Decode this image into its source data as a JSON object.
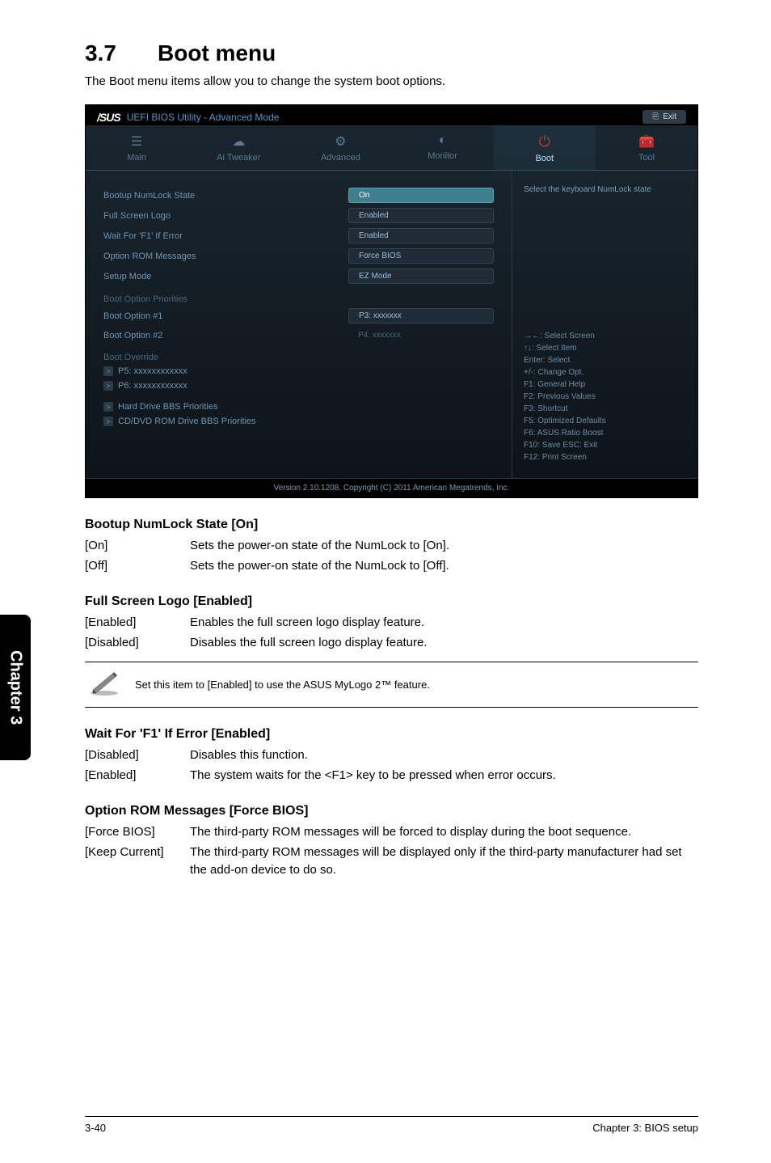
{
  "section": {
    "number": "3.7",
    "title": "Boot menu"
  },
  "intro": "The Boot menu items allow you to change the system boot options.",
  "bios": {
    "logo_brand": "/SUS",
    "header_title": "UEFI BIOS Utility - Advanced Mode",
    "exit_label": "Exit",
    "tabs": {
      "main": "Main",
      "ai": "Ai  Tweaker",
      "advanced": "Advanced",
      "monitor": "Monitor",
      "boot": "Boot",
      "tool": "Tool"
    },
    "rows": {
      "numlock": {
        "label": "Bootup NumLock State",
        "value": "On"
      },
      "logo": {
        "label": "Full Screen Logo",
        "value": "Enabled"
      },
      "f1": {
        "label": "Wait For 'F1' If Error",
        "value": "Enabled"
      },
      "rom": {
        "label": "Option ROM Messages",
        "value": "Force BIOS"
      },
      "setup": {
        "label": "Setup Mode",
        "value": "EZ Mode"
      }
    },
    "priorities_header": "Boot Option Priorities",
    "boot1": {
      "label": "Boot Option #1",
      "value": "P3: xxxxxxx"
    },
    "boot2": {
      "label": "Boot Option #2",
      "value": "P4: xxxxxxx"
    },
    "override_header": "Boot Override",
    "override": {
      "p5": "P5: xxxxxxxxxxxx",
      "p6": "P6: xxxxxxxxxxxx",
      "hdd": "Hard Drive BBS Priorities",
      "cd": "CD/DVD ROM Drive BBS Priorities"
    },
    "help_top": "Select the keyboard NumLock state",
    "help_keys": "→←:  Select Screen\n↑↓:  Select Item\nEnter:  Select\n+/-:  Change Opt.\nF1:  General Help\nF2:  Previous Values\nF3:  Shortcut\nF5:  Optimized Defaults\nF6:  ASUS Ratio Boost\nF10:  Save   ESC:  Exit\nF12:  Print Screen",
    "footer": "Version  2.10.1208.   Copyright  (C)  2011 American  Megatrends,  Inc."
  },
  "doc": {
    "numlock": {
      "title": "Bootup NumLock State [On]",
      "on": {
        "k": "[On]",
        "v": "Sets the power-on state of the NumLock to [On]."
      },
      "off": {
        "k": "[Off]",
        "v": "Sets the power-on state of the NumLock to [Off]."
      }
    },
    "logo": {
      "title": "Full Screen Logo [Enabled]",
      "en": {
        "k": "[Enabled]",
        "v": "Enables the full screen logo display feature."
      },
      "dis": {
        "k": "[Disabled]",
        "v": "Disables the full screen logo display feature."
      },
      "note": "Set this item to [Enabled] to use the ASUS MyLogo 2™ feature."
    },
    "f1": {
      "title": "Wait For 'F1' If Error [Enabled]",
      "dis": {
        "k": "[Disabled]",
        "v": "Disables this function."
      },
      "en": {
        "k": "[Enabled]",
        "v": "The system waits for the <F1> key to be pressed when error occurs."
      }
    },
    "rom": {
      "title": "Option ROM Messages [Force BIOS]",
      "force": {
        "k": "[Force BIOS]",
        "v": "The third-party ROM messages will be forced to display during the boot sequence."
      },
      "keep": {
        "k": "[Keep Current]",
        "v": "The third-party ROM messages will be displayed only if the third-party manufacturer had set the add-on device to do so."
      }
    }
  },
  "sidebar": "Chapter 3",
  "footer": {
    "left": "3-40",
    "right": "Chapter 3: BIOS setup"
  }
}
